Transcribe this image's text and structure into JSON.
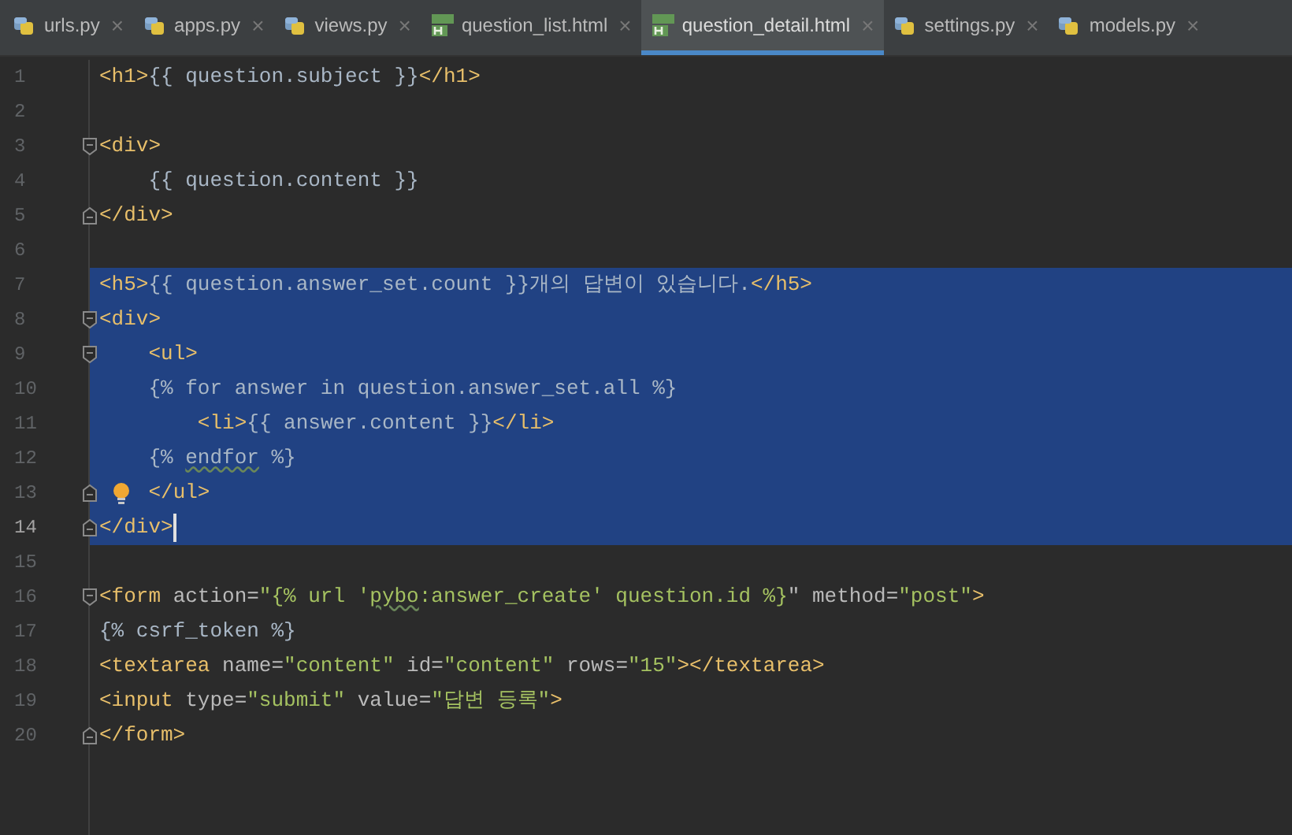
{
  "tabs": [
    {
      "label": "urls.py",
      "kind": "python",
      "selected": false
    },
    {
      "label": "apps.py",
      "kind": "python",
      "selected": false
    },
    {
      "label": "views.py",
      "kind": "python",
      "selected": false
    },
    {
      "label": "question_list.html",
      "kind": "html",
      "selected": false
    },
    {
      "label": "question_detail.html",
      "kind": "html",
      "selected": true
    },
    {
      "label": "settings.py",
      "kind": "python",
      "selected": false
    },
    {
      "label": "models.py",
      "kind": "python",
      "selected": false
    }
  ],
  "close_glyph": "×",
  "lines": [
    {
      "number": "1",
      "selected": false,
      "current": false,
      "tokens": [
        {
          "kind": "tag",
          "text": "<h1>"
        },
        {
          "kind": "text",
          "text": "{{ question.subject }}"
        },
        {
          "kind": "tag",
          "text": "</h1>"
        }
      ]
    },
    {
      "number": "2",
      "selected": false,
      "current": false
    },
    {
      "number": "3",
      "selected": false,
      "current": false,
      "fold_start": true,
      "tokens": [
        {
          "kind": "tag",
          "text": "<div>"
        }
      ]
    },
    {
      "number": "4",
      "selected": false,
      "current": false,
      "tokens": [
        {
          "kind": "text",
          "text": "    {{ question.content }}"
        }
      ]
    },
    {
      "number": "5",
      "selected": false,
      "current": false,
      "fold_end": true,
      "tokens": [
        {
          "kind": "tag",
          "text": "</div>"
        }
      ]
    },
    {
      "number": "6",
      "selected": false,
      "current": false
    },
    {
      "number": "7",
      "selected": true,
      "current": false,
      "tokens": [
        {
          "kind": "tag",
          "text": "<h5>"
        },
        {
          "kind": "text",
          "text": "{{ question.answer_set.count }}개의 답변이 있습니다."
        },
        {
          "kind": "tag",
          "text": "</h5>"
        }
      ]
    },
    {
      "number": "8",
      "selected": true,
      "current": false,
      "fold_start": true,
      "tokens": [
        {
          "kind": "tag",
          "text": "<div>"
        }
      ]
    },
    {
      "number": "9",
      "selected": true,
      "current": false,
      "fold_start": true,
      "tokens": [
        {
          "kind": "tag",
          "text": "    <ul>"
        }
      ]
    },
    {
      "number": "10",
      "selected": true,
      "current": false,
      "tokens": [
        {
          "kind": "text",
          "text": "    {% for answer in question.answer_set.all %}"
        }
      ]
    },
    {
      "number": "11",
      "selected": true,
      "current": false,
      "tokens": [
        {
          "kind": "tag",
          "text": "        <li>"
        },
        {
          "kind": "text",
          "text": "{{ answer.content }}"
        },
        {
          "kind": "tag",
          "text": "</li>"
        }
      ]
    },
    {
      "number": "12",
      "selected": true,
      "current": false,
      "tokens": [
        {
          "kind": "text",
          "text": "    {% "
        },
        {
          "kind": "typo",
          "text": "endfor"
        },
        {
          "kind": "text",
          "text": " %}"
        }
      ]
    },
    {
      "number": "13",
      "selected": true,
      "current": false,
      "fold_end": true,
      "hint": true,
      "tokens": [
        {
          "kind": "tag",
          "text": "    </ul>"
        }
      ]
    },
    {
      "number": "14",
      "selected": true,
      "current": true,
      "fold_end": true,
      "tokens": [
        {
          "kind": "tag",
          "text": "</div>"
        }
      ]
    },
    {
      "number": "15",
      "selected": false,
      "current": false
    },
    {
      "number": "16",
      "selected": false,
      "current": false,
      "fold_start": true,
      "tokens": [
        {
          "kind": "tag",
          "text": "<form "
        },
        {
          "kind": "attr",
          "text": "action="
        },
        {
          "kind": "string",
          "text": "\"{% url '"
        },
        {
          "kind": "typo-string",
          "text": "pybo"
        },
        {
          "kind": "string",
          "text": ":answer_create' question.id %}"
        },
        {
          "kind": "attr",
          "text": "\" method="
        },
        {
          "kind": "string",
          "text": "\"post\""
        },
        {
          "kind": "tag",
          "text": ">"
        }
      ]
    },
    {
      "number": "17",
      "selected": false,
      "current": false,
      "tokens": [
        {
          "kind": "text",
          "text": "{% csrf_token %}"
        }
      ]
    },
    {
      "number": "18",
      "selected": false,
      "current": false,
      "tokens": [
        {
          "kind": "tag",
          "text": "<textarea "
        },
        {
          "kind": "attr",
          "text": "name="
        },
        {
          "kind": "string",
          "text": "\"content\""
        },
        {
          "kind": "attr",
          "text": " id="
        },
        {
          "kind": "string",
          "text": "\"content\""
        },
        {
          "kind": "attr",
          "text": " rows="
        },
        {
          "kind": "string",
          "text": "\"15\""
        },
        {
          "kind": "tag",
          "text": "></textarea>"
        }
      ]
    },
    {
      "number": "19",
      "selected": false,
      "current": false,
      "tokens": [
        {
          "kind": "tag",
          "text": "<input "
        },
        {
          "kind": "attr",
          "text": "type="
        },
        {
          "kind": "string",
          "text": "\"submit\""
        },
        {
          "kind": "attr",
          "text": " value="
        },
        {
          "kind": "string",
          "text": "\"답변 등록\""
        },
        {
          "kind": "tag",
          "text": ">"
        }
      ]
    },
    {
      "number": "20",
      "selected": false,
      "current": false,
      "fold_end": true,
      "tokens": [
        {
          "kind": "tag",
          "text": "</form>"
        }
      ]
    }
  ]
}
